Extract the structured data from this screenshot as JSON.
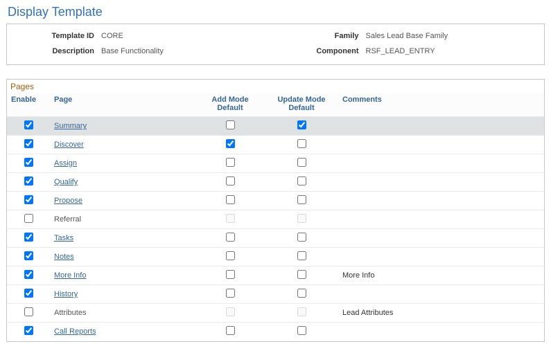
{
  "title": "Display Template",
  "header": {
    "template_id_label": "Template ID",
    "template_id_value": "CORE",
    "description_label": "Description",
    "description_value": "Base Functionality",
    "family_label": "Family",
    "family_value": "Sales Lead Base Family",
    "component_label": "Component",
    "component_value": "RSF_LEAD_ENTRY"
  },
  "section_title": "Pages",
  "columns": {
    "enable": "Enable",
    "page": "Page",
    "add": "Add Mode Default",
    "update": "Update Mode Default",
    "comments": "Comments"
  },
  "rows": [
    {
      "enable": true,
      "link": true,
      "first": "S",
      "rest": "ummary",
      "add": false,
      "update": true,
      "comments": "",
      "disabled": false
    },
    {
      "enable": true,
      "link": true,
      "first": "D",
      "rest": "iscover",
      "add": true,
      "update": false,
      "comments": "",
      "disabled": false
    },
    {
      "enable": true,
      "link": true,
      "first": "A",
      "rest": "ssign",
      "add": false,
      "update": false,
      "comments": "",
      "disabled": false
    },
    {
      "enable": true,
      "link": true,
      "first": "Q",
      "rest": "ualify",
      "add": false,
      "update": false,
      "comments": "",
      "disabled": false
    },
    {
      "enable": true,
      "link": true,
      "first": "P",
      "rest": "ropose",
      "add": false,
      "update": false,
      "comments": "",
      "disabled": false
    },
    {
      "enable": false,
      "link": false,
      "first": "",
      "rest": "Referral",
      "add": false,
      "update": false,
      "comments": "",
      "disabled": true
    },
    {
      "enable": true,
      "link": true,
      "first": "T",
      "rest": "asks",
      "add": false,
      "update": false,
      "comments": "",
      "disabled": false
    },
    {
      "enable": true,
      "link": true,
      "first": "N",
      "rest": "otes",
      "add": false,
      "update": false,
      "comments": "",
      "disabled": false
    },
    {
      "enable": true,
      "link": true,
      "first": "M",
      "rest": "ore Info",
      "add": false,
      "update": false,
      "comments": "More Info",
      "disabled": false
    },
    {
      "enable": true,
      "link": true,
      "first": "H",
      "rest": "istory",
      "add": false,
      "update": false,
      "comments": "",
      "disabled": false
    },
    {
      "enable": false,
      "link": false,
      "first": "",
      "rest": "Attributes",
      "add": false,
      "update": false,
      "comments": "Lead Attributes",
      "disabled": true
    },
    {
      "enable": true,
      "link": true,
      "first": "C",
      "rest": "all Reports",
      "add": false,
      "update": false,
      "comments": "",
      "disabled": false
    }
  ]
}
